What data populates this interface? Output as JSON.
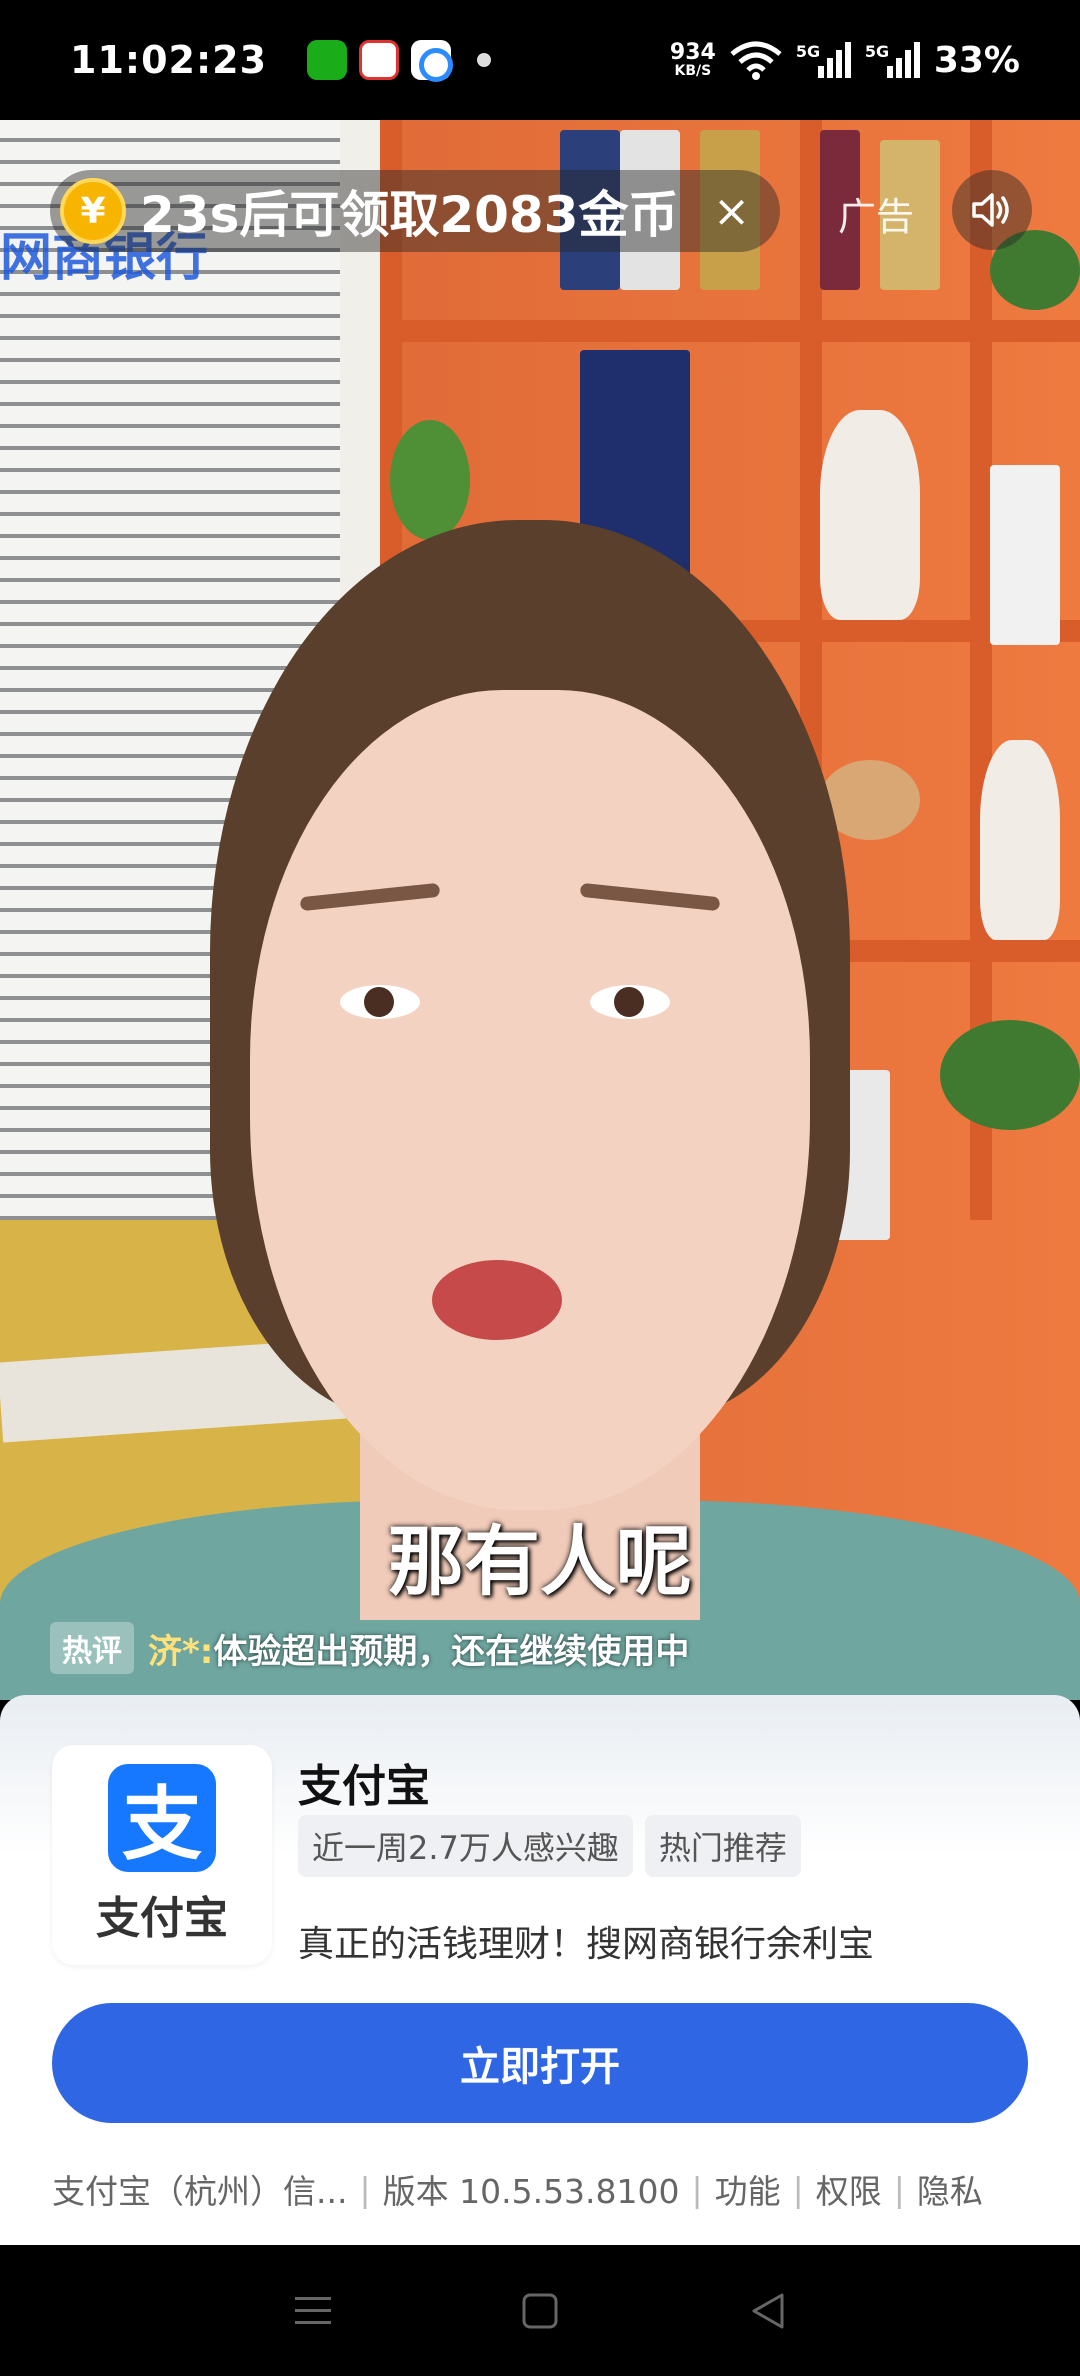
{
  "status_bar": {
    "time": "11:02:23",
    "net_speed_value": "934",
    "net_speed_unit": "KB/S",
    "signal1_label": "5G",
    "signal2_label": "5G",
    "battery": "33%"
  },
  "ad_overlay": {
    "coin_symbol": "¥",
    "reward_text": "23s后可领取2083金币",
    "close_symbol": "×",
    "ad_label": "广告",
    "watermark": "网商银行"
  },
  "video": {
    "subtitle": "那有人呢",
    "hot_tag": "热评",
    "hot_user": "济*:",
    "hot_text": "体验超出预期，还在继续使用中"
  },
  "ad_card": {
    "icon_glyph": "支",
    "icon_text": "支付宝",
    "app_name": "支付宝",
    "tags": [
      "近一周2.7万人感兴趣",
      "热门推荐"
    ],
    "description": "真正的活钱理财！搜网商银行余利宝",
    "open_button": "立即打开",
    "developer": "支付宝（杭州）信...",
    "version": "版本 10.5.53.8100",
    "link_features": "功能",
    "link_permissions": "权限",
    "link_privacy": "隐私"
  },
  "colors": {
    "primary_button": "#2f66e3",
    "alipay_blue": "#1677ff",
    "coin": "#f7b400"
  }
}
